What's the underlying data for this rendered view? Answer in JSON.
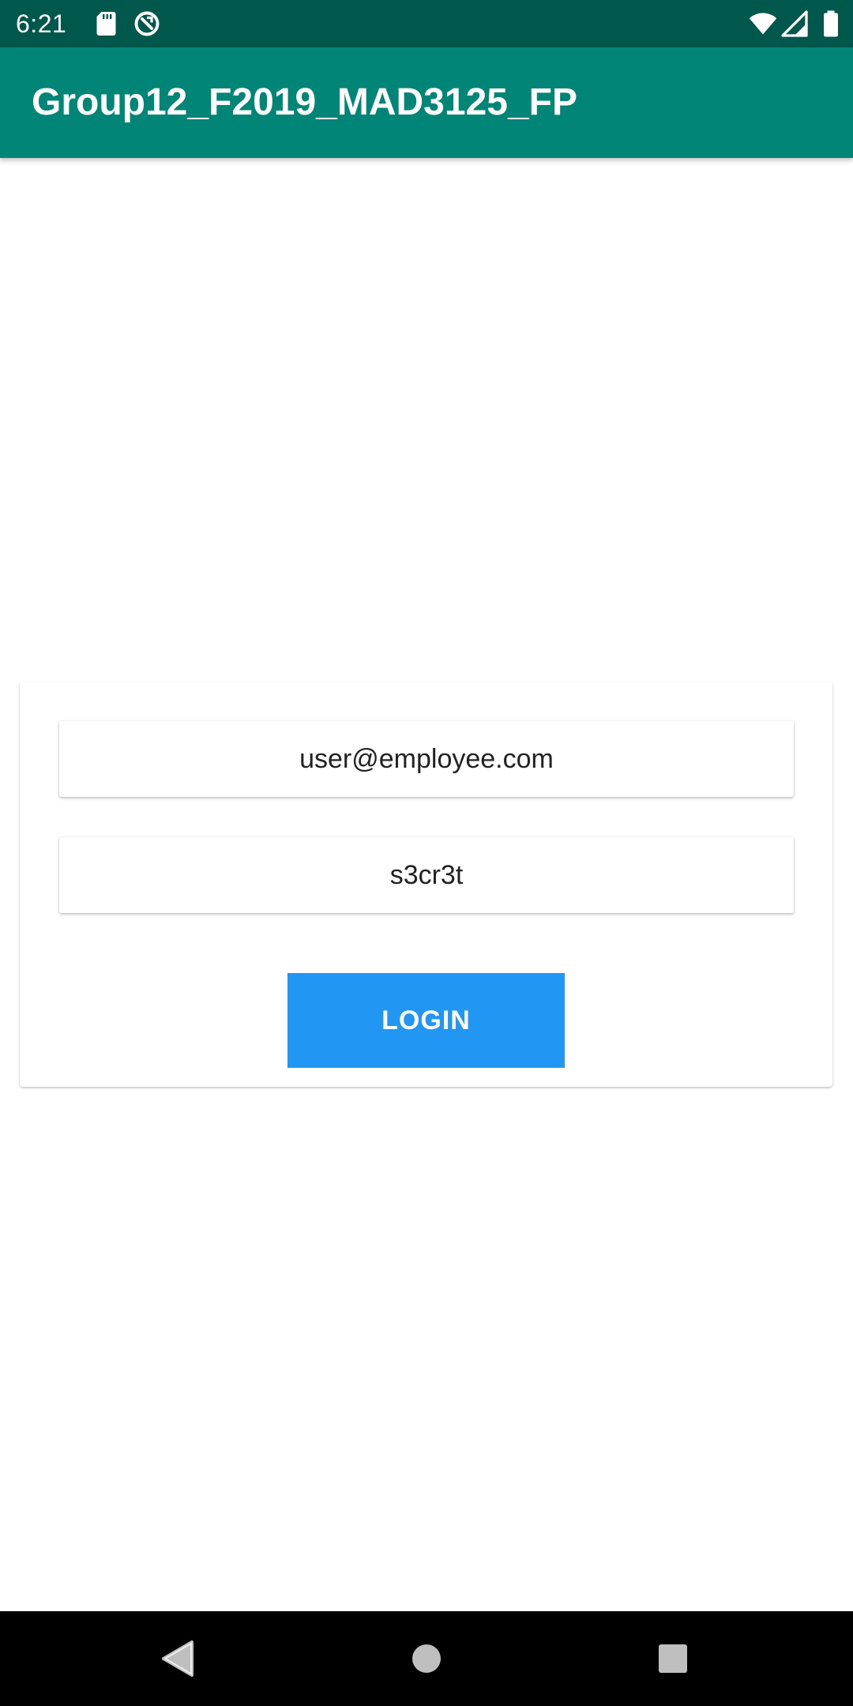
{
  "status_bar": {
    "time": "6:21",
    "icons": [
      "sd-card-icon",
      "data-saver-icon",
      "wifi-icon",
      "signal-icon",
      "battery-icon"
    ],
    "background": "#00574b"
  },
  "app_bar": {
    "title": "Group12_F2019_MAD3125_FP",
    "background": "#008577"
  },
  "login_form": {
    "email_value": "user@employee.com",
    "password_value": "s3cr3t",
    "login_label": "LOGIN",
    "button_color": "#2196f3"
  },
  "nav_bar": {
    "buttons": [
      "back-icon",
      "home-icon",
      "recents-icon"
    ]
  }
}
